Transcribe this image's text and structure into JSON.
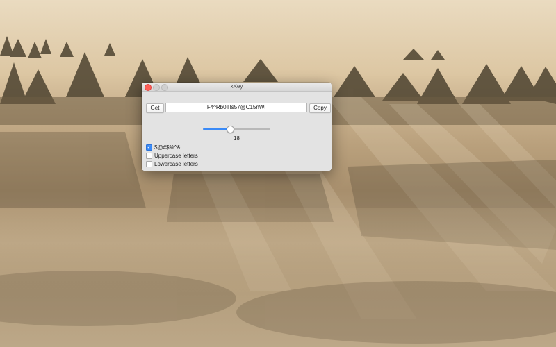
{
  "desktop": {
    "wallpaper": "foggy-forest-sepia"
  },
  "window": {
    "title": "xKey",
    "controls": {
      "close": "close-button",
      "minimize": "minimize-button",
      "zoom": "zoom-button"
    }
  },
  "generator": {
    "get_label": "Get",
    "copy_label": "Copy",
    "password_value": "F4^Rb0T!s57@C15nWi",
    "length_value": "18",
    "slider_fraction": 0.4
  },
  "options": [
    {
      "label": "$@#$%^&",
      "checked": true
    },
    {
      "label": "Uppercase letters",
      "checked": false
    },
    {
      "label": "Lowercase letters",
      "checked": false
    }
  ],
  "colors": {
    "accent": "#3a8af7",
    "close": "#fd5f57"
  }
}
